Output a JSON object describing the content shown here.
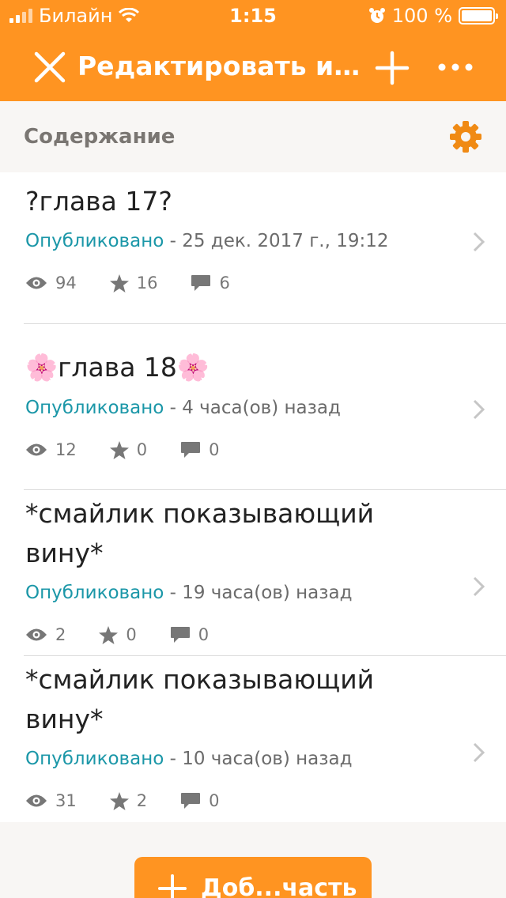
{
  "status": {
    "carrier": "Билайн",
    "time": "1:15",
    "battery": "100 %"
  },
  "nav": {
    "title": "Редактировать ис..."
  },
  "section": {
    "label": "Содержание"
  },
  "chapters": [
    {
      "title": "?глава 17?",
      "status": "Опубликовано",
      "date": " - 25 дек. 2017 г., 19:12",
      "views": "94",
      "votes": "16",
      "comments": "6"
    },
    {
      "title": "🌸глава 18🌸",
      "status": "Опубликовано",
      "date": " - 4 часа(ов) назад",
      "views": "12",
      "votes": "0",
      "comments": "0"
    },
    {
      "title": "*смайлик показывающий вину*",
      "status": "Опубликовано",
      "date": " - 19 часа(ов) назад",
      "views": "2",
      "votes": "0",
      "comments": "0"
    },
    {
      "title": "*смайлик показывающий вину*",
      "status": "Опубликовано",
      "date": " - 10 часа(ов) назад",
      "views": "31",
      "votes": "2",
      "comments": "0"
    }
  ],
  "add_button": {
    "label": "Доб...часть"
  }
}
